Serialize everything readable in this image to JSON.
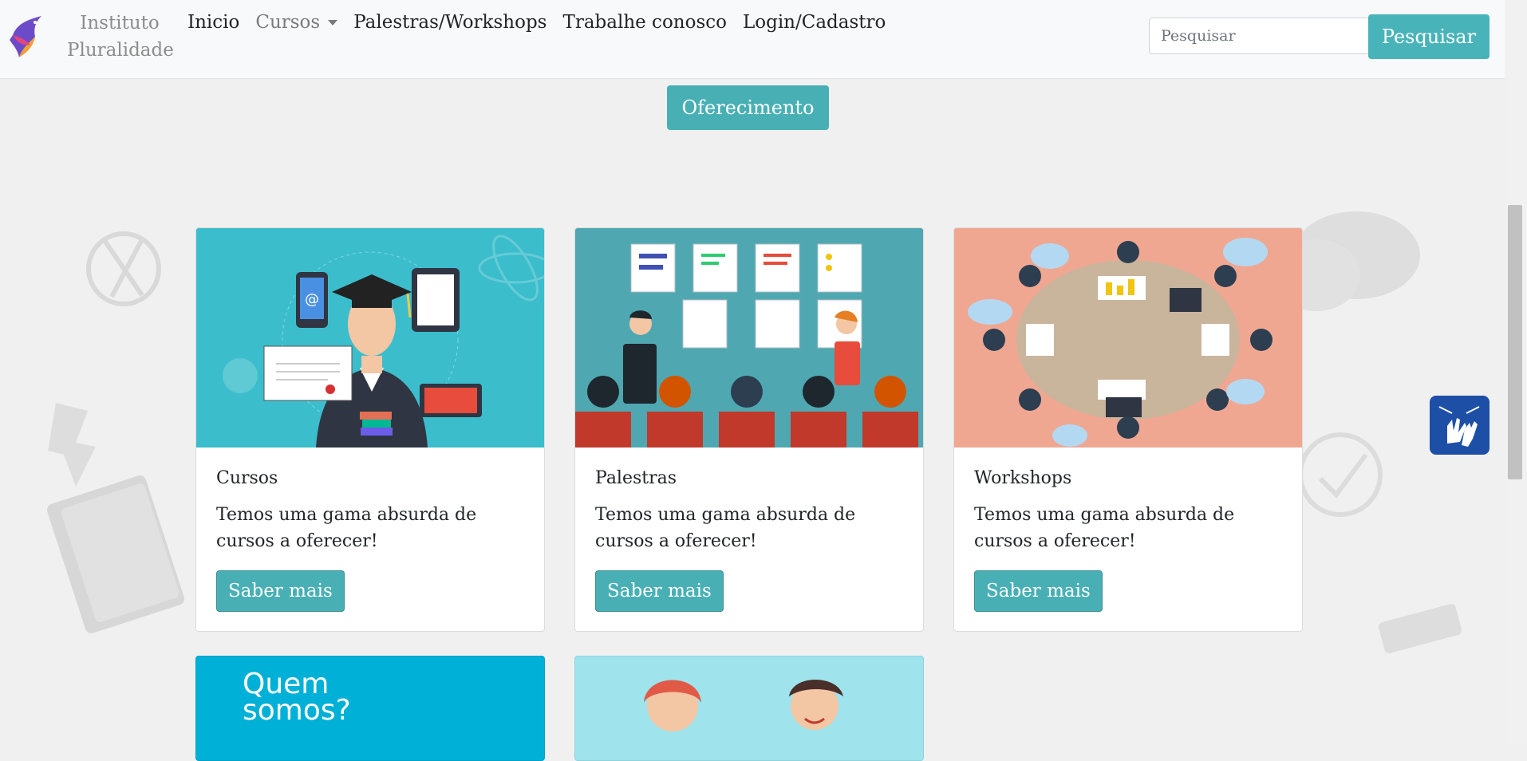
{
  "brand": {
    "line1": "Instituto",
    "line2": "Pluralidade"
  },
  "nav": {
    "inicio": "Inicio",
    "cursos": "Cursos",
    "palestras_workshops": "Palestras/Workshops",
    "trabalhe": "Trabalhe conosco",
    "login": "Login/Cadastro"
  },
  "search": {
    "placeholder": "Pesquisar",
    "button": "Pesquisar"
  },
  "offer_button": "Oferecimento",
  "cards": [
    {
      "title": "Cursos",
      "text": "Temos uma gama absurda de cursos a oferecer!",
      "button": "Saber mais",
      "image_icon": "graduate-illustration"
    },
    {
      "title": "Palestras",
      "text": "Temos uma gama absurda de cursos a oferecer!",
      "button": "Saber mais",
      "image_icon": "presentation-illustration"
    },
    {
      "title": "Workshops",
      "text": "Temos uma gama absurda de cursos a oferecer!",
      "button": "Saber mais",
      "image_icon": "meeting-table-illustration"
    }
  ],
  "bottom_cards": [
    {
      "image_text_1": "Quem",
      "image_text_2": "somos?"
    },
    {
      "image_icon": "people-illustration"
    }
  ],
  "colors": {
    "accent": "#48b0b5",
    "navbar": "#f8f9fa",
    "libras": "#1d4fa6"
  },
  "widget": {
    "icon": "hand-sign-language-icon"
  }
}
